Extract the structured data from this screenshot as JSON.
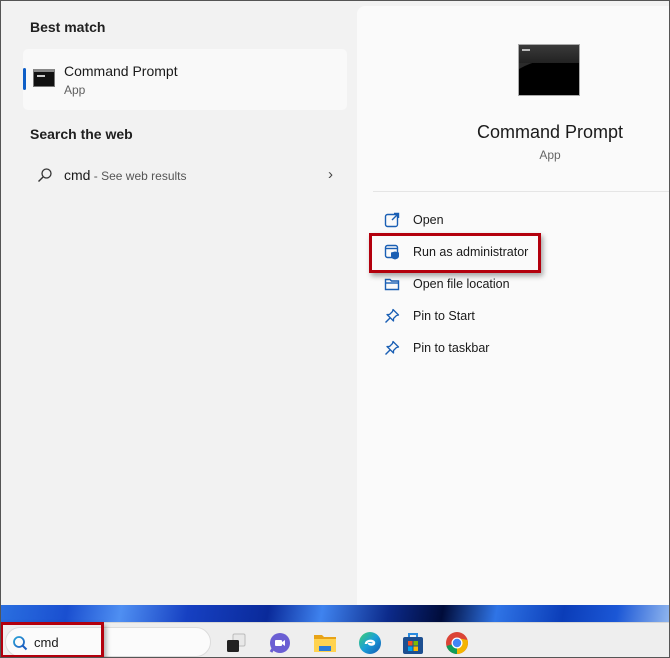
{
  "left": {
    "best_match_title": "Best match",
    "best_match": {
      "name": "Command Prompt",
      "type": "App"
    },
    "search_web_title": "Search the web",
    "web_result": {
      "query": "cmd",
      "separator": " - ",
      "hint": "See web results"
    }
  },
  "detail": {
    "name": "Command Prompt",
    "type": "App",
    "actions": [
      {
        "label": "Open",
        "icon": "open-external-icon"
      },
      {
        "label": "Run as administrator",
        "icon": "shield-window-icon",
        "highlighted": true
      },
      {
        "label": "Open file location",
        "icon": "folder-icon"
      },
      {
        "label": "Pin to Start",
        "icon": "pin-icon"
      },
      {
        "label": "Pin to taskbar",
        "icon": "pin-icon"
      }
    ]
  },
  "taskbar": {
    "search_value": "cmd",
    "apps": [
      "task-view",
      "teams-chat",
      "file-explorer",
      "edge",
      "microsoft-store",
      "chrome"
    ]
  },
  "colors": {
    "accent": "#0f5fc7",
    "highlight_box": "#b3000d",
    "icon_blue": "#1a5fb4"
  }
}
